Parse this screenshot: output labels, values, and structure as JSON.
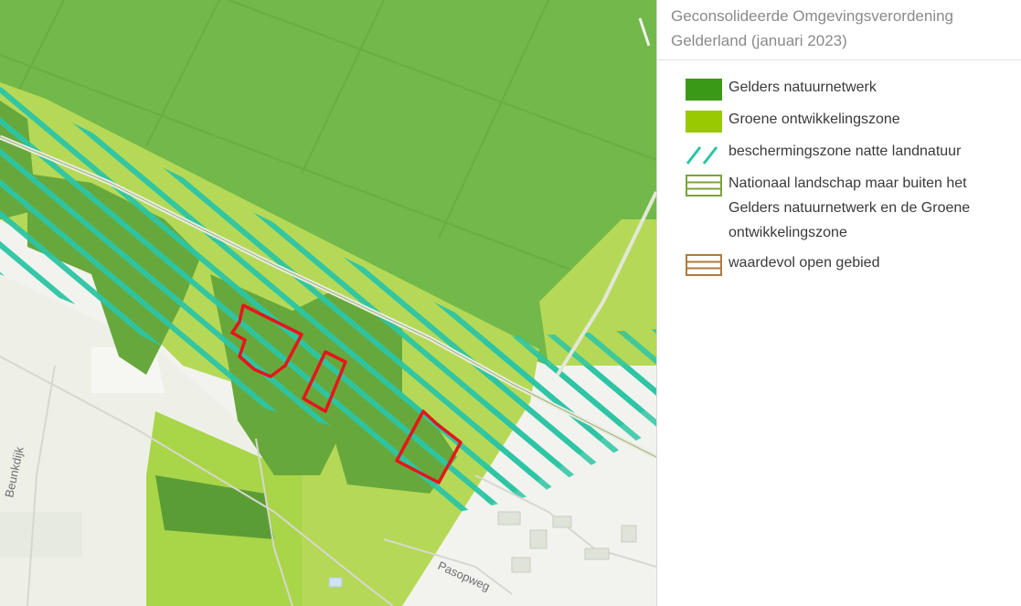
{
  "legend": {
    "title": "Geconsolideerde Omgevingsverordening Gelderland (januari 2023)",
    "items": [
      {
        "label": "Gelders natuurnetwerk",
        "icon": "solid-dark-green-swatch",
        "color": "#3a9a16"
      },
      {
        "label": "Groene ontwikkelingszone",
        "icon": "solid-light-green-swatch",
        "color": "#99c900"
      },
      {
        "label": "beschermingszone natte landnatuur",
        "icon": "teal-diagonal-hatch-swatch",
        "color": "#2cc5a4"
      },
      {
        "label": "Nationaal landschap maar buiten het Gelders natuurnetwerk en de Groene ontwikkelingszone",
        "icon": "olive-horizontal-lines-swatch",
        "color": "#7ba33a"
      },
      {
        "label": "waardevol open gebied",
        "icon": "brown-horizontal-lines-swatch",
        "color": "#b07a3a"
      }
    ]
  },
  "map": {
    "road_labels": [
      "Beunkdijk",
      "Pasopweg"
    ],
    "highlight_color": "#e8141b"
  }
}
